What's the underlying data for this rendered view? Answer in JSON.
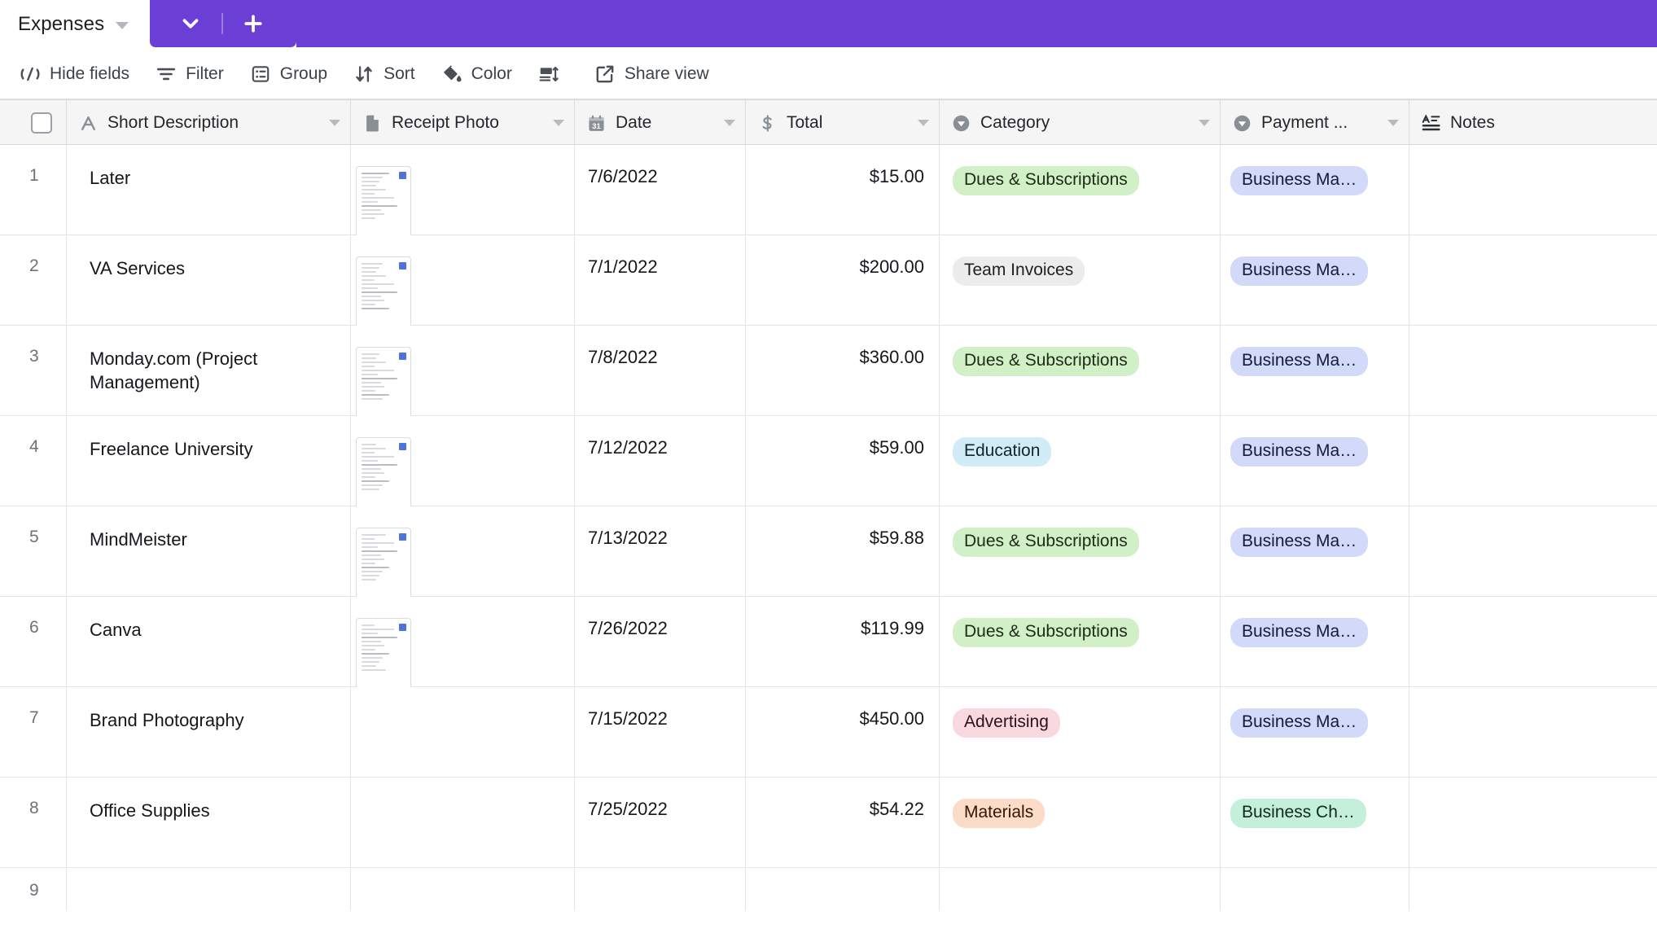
{
  "tabbar": {
    "active_tab": "Expenses",
    "tab_caret_icon": "chevron-down-icon",
    "purple_chevron_icon": "chevron-down-icon",
    "purple_plus_icon": "plus-icon",
    "accent_color": "#6b3ed6"
  },
  "toolbar": {
    "items": [
      {
        "label": "Hide fields",
        "icon": "hide-fields-icon"
      },
      {
        "label": "Filter",
        "icon": "filter-icon"
      },
      {
        "label": "Group",
        "icon": "group-icon"
      },
      {
        "label": "Sort",
        "icon": "sort-icon"
      },
      {
        "label": "Color",
        "icon": "color-paint-icon"
      },
      {
        "label": "",
        "icon": "row-height-icon"
      },
      {
        "label": "Share view",
        "icon": "share-external-icon"
      }
    ]
  },
  "grid": {
    "select_all_checkbox": "select-all-checkbox",
    "columns": [
      {
        "key": "desc",
        "label": "Short Description",
        "icon": "text-field-icon",
        "caret": true
      },
      {
        "key": "photo",
        "label": "Receipt Photo",
        "icon": "attachment-file-icon",
        "caret": true
      },
      {
        "key": "date",
        "label": "Date",
        "icon": "calendar-31-icon",
        "caret": true
      },
      {
        "key": "total",
        "label": "Total",
        "icon": "currency-dollar-icon",
        "caret": true
      },
      {
        "key": "cat",
        "label": "Category",
        "icon": "single-select-icon",
        "caret": true
      },
      {
        "key": "pay",
        "label": "Payment ...",
        "icon": "single-select-icon",
        "caret": true
      },
      {
        "key": "notes",
        "label": "Notes",
        "icon": "long-text-icon",
        "caret": false
      }
    ],
    "rows": [
      {
        "num": "1",
        "desc": "Later",
        "has_photo": true,
        "date": "7/6/2022",
        "total": "$15.00",
        "category": "Dues & Subscriptions",
        "cat_color": "green",
        "payment": "Business Ma…",
        "pay_color": "periwinkle",
        "notes": ""
      },
      {
        "num": "2",
        "desc": "VA Services",
        "has_photo": true,
        "date": "7/1/2022",
        "total": "$200.00",
        "category": "Team Invoices",
        "cat_color": "gray",
        "payment": "Business Ma…",
        "pay_color": "periwinkle",
        "notes": ""
      },
      {
        "num": "3",
        "desc": "Monday.com (Project Management)",
        "has_photo": true,
        "date": "7/8/2022",
        "total": "$360.00",
        "category": "Dues & Subscriptions",
        "cat_color": "green",
        "payment": "Business Ma…",
        "pay_color": "periwinkle",
        "notes": ""
      },
      {
        "num": "4",
        "desc": "Freelance University",
        "has_photo": true,
        "date": "7/12/2022",
        "total": "$59.00",
        "category": "Education",
        "cat_color": "blue",
        "payment": "Business Ma…",
        "pay_color": "periwinkle",
        "notes": ""
      },
      {
        "num": "5",
        "desc": "MindMeister",
        "has_photo": true,
        "date": "7/13/2022",
        "total": "$59.88",
        "category": "Dues & Subscriptions",
        "cat_color": "green",
        "payment": "Business Ma…",
        "pay_color": "periwinkle",
        "notes": ""
      },
      {
        "num": "6",
        "desc": "Canva",
        "has_photo": true,
        "date": "7/26/2022",
        "total": "$119.99",
        "category": "Dues & Subscriptions",
        "cat_color": "green",
        "payment": "Business Ma…",
        "pay_color": "periwinkle",
        "notes": ""
      },
      {
        "num": "7",
        "desc": "Brand Photography",
        "has_photo": false,
        "date": "7/15/2022",
        "total": "$450.00",
        "category": "Advertising",
        "cat_color": "pink",
        "payment": "Business Ma…",
        "pay_color": "periwinkle",
        "notes": ""
      },
      {
        "num": "8",
        "desc": "Office Supplies",
        "has_photo": false,
        "date": "7/25/2022",
        "total": "$54.22",
        "category": "Materials",
        "cat_color": "orange",
        "payment": "Business Ch…",
        "pay_color": "mint",
        "notes": ""
      },
      {
        "num": "9",
        "desc": "",
        "has_photo": false,
        "date": "",
        "total": "",
        "category": "",
        "cat_color": "",
        "payment": "",
        "pay_color": "",
        "notes": ""
      }
    ],
    "tag_colors": {
      "green": {
        "bg": "#d2f0c8",
        "fg": "#1b2b14"
      },
      "gray": {
        "bg": "#ececed",
        "fg": "#1d1f22"
      },
      "blue": {
        "bg": "#cfecf7",
        "fg": "#10252e"
      },
      "pink": {
        "bg": "#f9d8e0",
        "fg": "#2d1119"
      },
      "orange": {
        "bg": "#fadcc8",
        "fg": "#331706"
      },
      "periwinkle": {
        "bg": "#d3d9f8",
        "fg": "#141c3a"
      },
      "mint": {
        "bg": "#c3efdb",
        "fg": "#0d2a1d"
      }
    }
  }
}
